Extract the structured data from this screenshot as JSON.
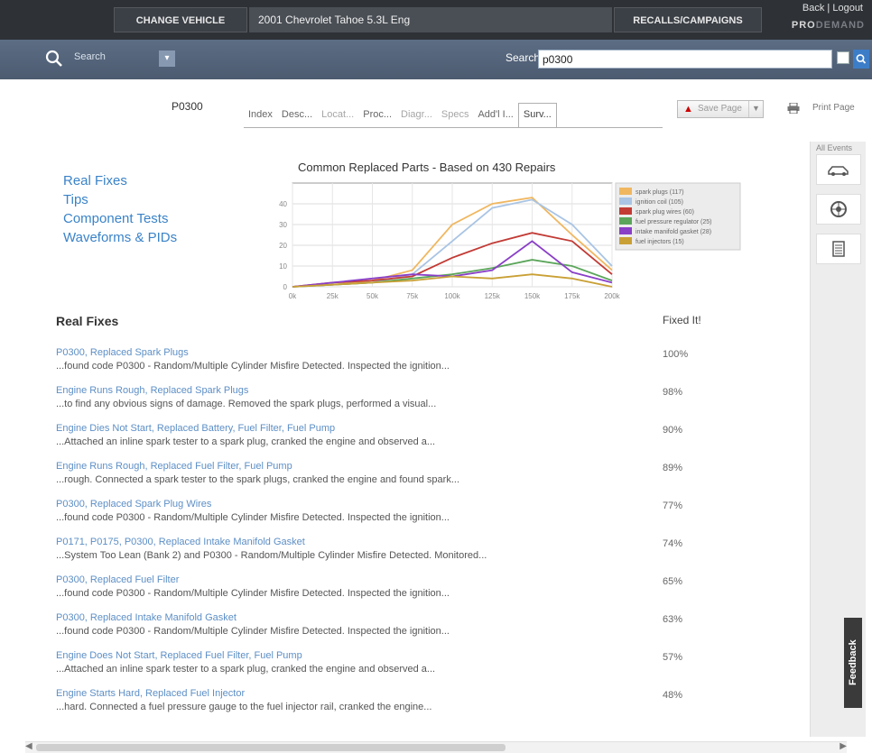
{
  "topbar": {
    "change_vehicle": "CHANGE VEHICLE",
    "vehicle": "2001 Chevrolet Tahoe 5.3L Eng",
    "recalls": "RECALLS/CAMPAIGNS",
    "login": "Back | Logout",
    "brand_pro": "PRO",
    "brand_demand": "DEMAND"
  },
  "searchbar": {
    "mode_label": "Search",
    "search_label": "Search",
    "query": "p0300"
  },
  "code_header": "P0300",
  "tabs": [
    "Index",
    "Desc...",
    "Locat...",
    "Proc...",
    "Diagr...",
    "Specs",
    "Add'l I...",
    "Surv..."
  ],
  "save": {
    "label": "Save Page",
    "icon": "pdf-icon"
  },
  "print_label": "Print Page",
  "quick_links": [
    "Real Fixes",
    "Tips",
    "Component Tests",
    "Waveforms & PIDs"
  ],
  "rail": {
    "label": "All Events",
    "buttons": [
      "car-icon",
      "wheel-icon",
      "document-icon"
    ]
  },
  "feedback": "Feedback",
  "chart_data": {
    "type": "line",
    "title": "Common Replaced Parts - Based on 430 Repairs",
    "x": [
      "0k",
      "25k",
      "50k",
      "75k",
      "100k",
      "125k",
      "150k",
      "175k",
      "200k"
    ],
    "ylim": [
      0,
      50
    ],
    "yticks": [
      0,
      10,
      20,
      30,
      40
    ],
    "grid": true,
    "legend_position": "right",
    "series": [
      {
        "name": "spark plugs (117)",
        "color": "#f0b760",
        "values": [
          0,
          1,
          3,
          8,
          30,
          40,
          43,
          25,
          8
        ]
      },
      {
        "name": "ignition coil (105)",
        "color": "#a9c4e4",
        "values": [
          0,
          1,
          2,
          6,
          22,
          38,
          42,
          30,
          10
        ]
      },
      {
        "name": "spark plug wires (60)",
        "color": "#c23b35",
        "values": [
          0,
          2,
          3,
          5,
          14,
          21,
          26,
          22,
          6
        ]
      },
      {
        "name": "fuel pressure regulator (25)",
        "color": "#5aa55a",
        "values": [
          0,
          1,
          2,
          4,
          6,
          9,
          13,
          10,
          3
        ]
      },
      {
        "name": "intake manifold gasket (28)",
        "color": "#8a3fc7",
        "values": [
          0,
          2,
          4,
          6,
          5,
          8,
          22,
          7,
          2
        ]
      },
      {
        "name": "fuel injectors (15)",
        "color": "#c9a035",
        "values": [
          0,
          1,
          2,
          3,
          5,
          4,
          6,
          4,
          0
        ]
      }
    ]
  },
  "real_fixes": {
    "title": "Real Fixes",
    "fixed_it_label": "Fixed It!",
    "items": [
      {
        "title": "P0300, Replaced Spark Plugs",
        "desc": "...found code P0300 - Random/Multiple Cylinder Misfire Detected. Inspected the ignition...",
        "count": "100%"
      },
      {
        "title": "Engine Runs Rough, Replaced Spark Plugs",
        "desc": "...to find any obvious signs of damage. Removed the spark plugs, performed a visual...",
        "count": "98%"
      },
      {
        "title": "Engine Dies Not Start, Replaced Battery, Fuel Filter, Fuel Pump",
        "desc": "...Attached an inline spark tester to a spark plug, cranked the engine and observed a...",
        "count": "90%"
      },
      {
        "title": "Engine Runs Rough, Replaced Fuel Filter, Fuel Pump",
        "desc": "...rough. Connected a spark tester to the spark plugs, cranked the engine and found spark...",
        "count": "89%"
      },
      {
        "title": "P0300, Replaced Spark Plug Wires",
        "desc": "...found code P0300 - Random/Multiple Cylinder Misfire Detected. Inspected the ignition...",
        "count": "77%"
      },
      {
        "title": "P0171, P0175, P0300, Replaced Intake Manifold Gasket",
        "desc": "...System Too Lean (Bank 2) and P0300 - Random/Multiple Cylinder Misfire Detected. Monitored...",
        "count": "74%"
      },
      {
        "title": "P0300, Replaced Fuel Filter",
        "desc": "...found code P0300 - Random/Multiple Cylinder Misfire Detected. Inspected the ignition...",
        "count": "65%"
      },
      {
        "title": "P0300, Replaced Intake Manifold Gasket",
        "desc": "...found code P0300 - Random/Multiple Cylinder Misfire Detected. Inspected the ignition...",
        "count": "63%"
      },
      {
        "title": "Engine Does Not Start, Replaced Fuel Filter, Fuel Pump",
        "desc": "...Attached an inline spark tester to a spark plug, cranked the engine and observed a...",
        "count": "57%"
      },
      {
        "title": "Engine Starts Hard, Replaced Fuel Injector",
        "desc": "...hard. Connected a fuel pressure gauge to the fuel injector rail, cranked the engine...",
        "count": "48%"
      }
    ]
  }
}
